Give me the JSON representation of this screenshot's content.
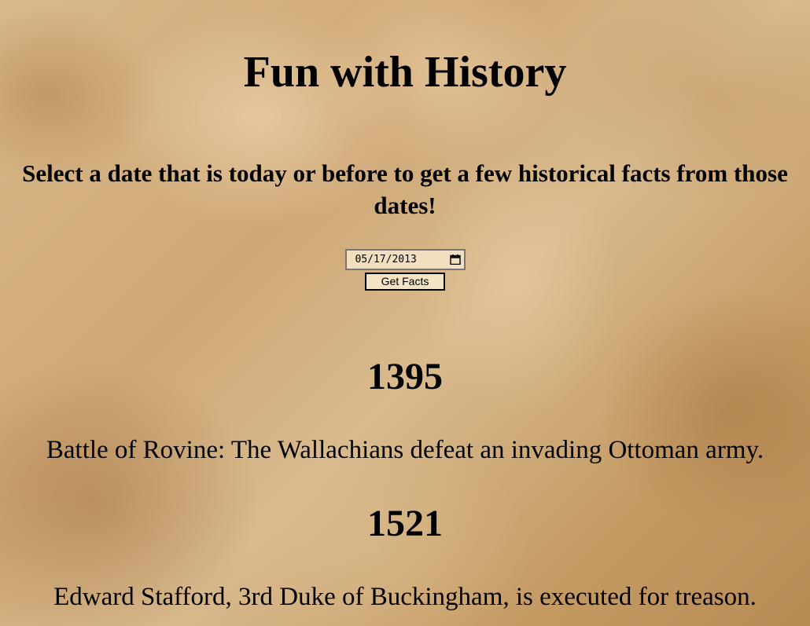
{
  "page": {
    "title": "Fun with History",
    "subtitle": "Select a date that is today or before to get a few historical facts from those dates!"
  },
  "form": {
    "date_value": "05/17/2013",
    "calendar_icon": "calendar-icon",
    "button_label": "Get Facts"
  },
  "facts": [
    {
      "year": "1395",
      "text": "Battle of Rovine: The Wallachians defeat an invading Ottoman army."
    },
    {
      "year": "1521",
      "text": "Edward Stafford, 3rd Duke of Buckingham, is executed for treason."
    }
  ],
  "colors": {
    "paper": "#c9a36e",
    "input_bg": "#f1dfc0",
    "button_bg": "#f4e4c6"
  }
}
